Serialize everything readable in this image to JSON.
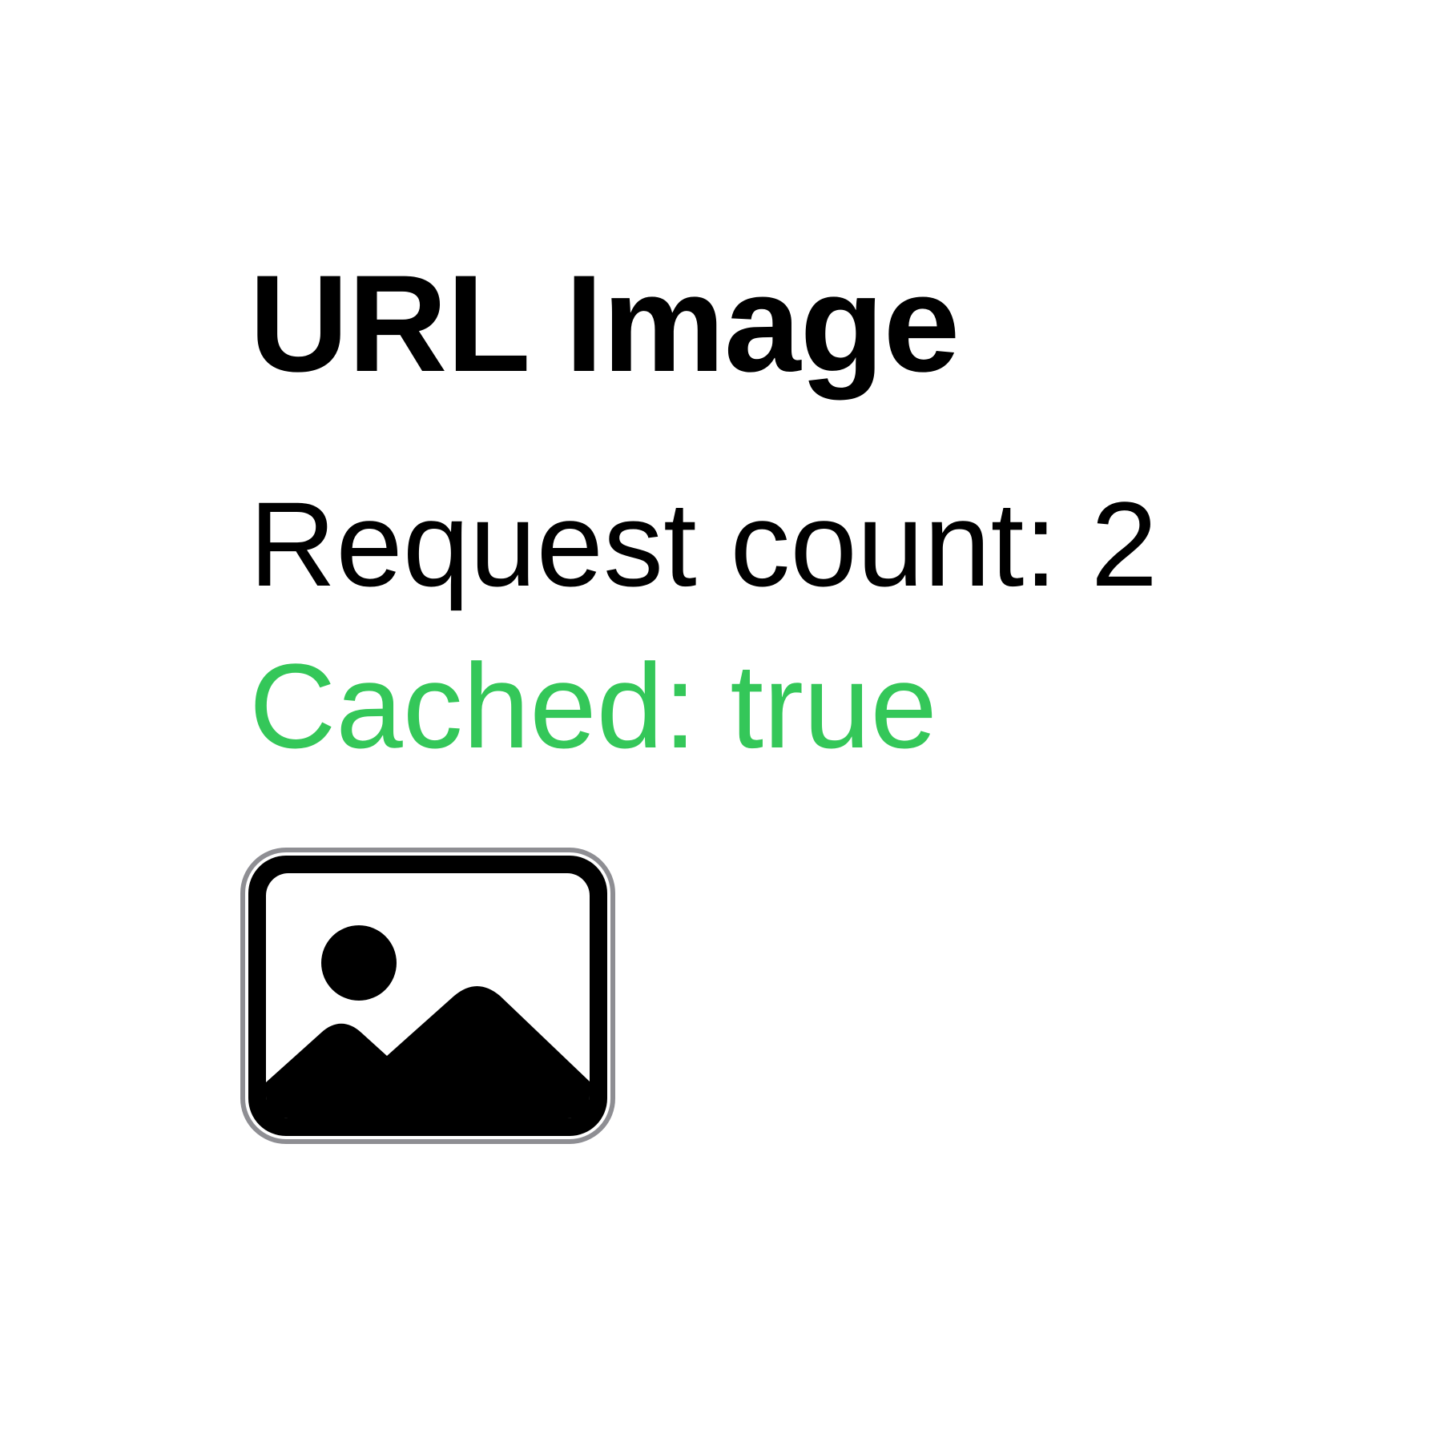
{
  "page": {
    "title": "URL Image",
    "request_count_label": "Request count: 2",
    "cached_label": "Cached: true",
    "image_icon": "photo-placeholder-icon"
  },
  "colors": {
    "text": "#000000",
    "cached": "#34C759",
    "icon_border": "#8E8E93",
    "background": "#FFFFFF"
  }
}
